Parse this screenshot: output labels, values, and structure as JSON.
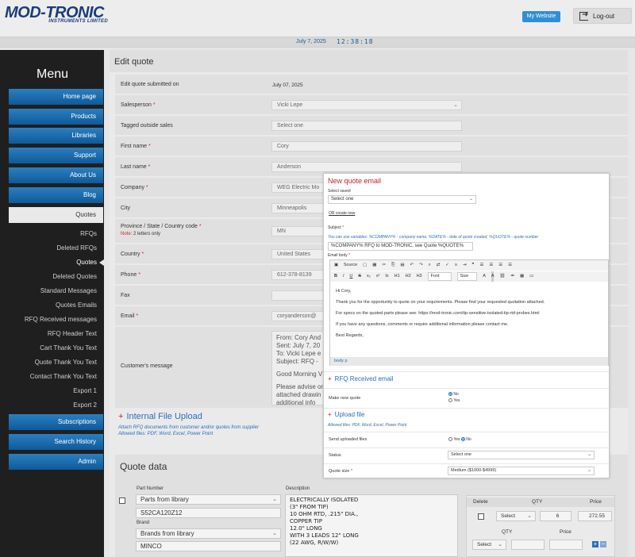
{
  "header": {
    "logo_main": "MOD-TRONIC",
    "logo_sub": "INSTRUMENTS LIMITED",
    "my_website": "My Website",
    "logout": "Log-out",
    "date": "July 7, 2025",
    "time": "12:38:18"
  },
  "sidebar": {
    "title": "Menu",
    "buttons": [
      "Home page",
      "Products",
      "Libraries",
      "Support",
      "About Us",
      "Blog",
      "Quotes"
    ],
    "sub_items": [
      "RFQs",
      "Deleted RFQs",
      "Quotes",
      "Deleted Quotes",
      "Standard Messages",
      "Quotes Emails",
      "RFQ Received messages",
      "RFQ Header Text",
      "Cart Thank You Text",
      "Quote Thank You Text",
      "Contact Thank You Text",
      "Export 1",
      "Export 2"
    ],
    "lower_buttons": [
      "Subscriptions",
      "Search History",
      "Admin"
    ]
  },
  "main": {
    "title": "Edit quote",
    "fields": [
      {
        "label": "Edit quote submitted on",
        "required": false,
        "value": "July 07, 2025"
      },
      {
        "label": "Salesperson",
        "required": true,
        "value": "Vicki Lepe"
      },
      {
        "label": "Tagged outside sales",
        "required": false,
        "value": "Select one"
      },
      {
        "label": "First name",
        "required": true,
        "value": "Cory"
      },
      {
        "label": "Last name",
        "required": true,
        "value": "Anderson"
      },
      {
        "label": "Company",
        "required": true,
        "value": "WEG Electric Mo"
      },
      {
        "label": "City",
        "required": false,
        "value": "Minneapolis"
      },
      {
        "label": "Province / State / Country code",
        "required": true,
        "value": "MN",
        "note_prefix": "Note:",
        "note": "2 letters only"
      },
      {
        "label": "Country",
        "required": true,
        "value": "United States"
      },
      {
        "label": "Phone",
        "required": true,
        "value": "612-378-8139"
      },
      {
        "label": "Fax",
        "required": false,
        "value": ""
      },
      {
        "label": "Email",
        "required": true,
        "value": "coryanderson@"
      },
      {
        "label": "Customer's message",
        "required": false,
        "value": ""
      }
    ],
    "message_lines": [
      "From: Cory And",
      "Sent: July 7, 20",
      "To: Vicki Lepe e",
      "Subject: RFQ -",
      "Good Morning V",
      "Please advise or",
      "attached drawin",
      "additional info"
    ],
    "upload": {
      "title": "Internal File Upload",
      "desc1": "Attach RFQ documents from customer and/or quotes from supplier",
      "desc2": "Allowed files: PDF, Word, Excel, Power Point"
    },
    "quote_data": {
      "title": "Quote data",
      "part_label": "Part Number",
      "part_select": "Parts from library",
      "part_number": "S52CA120Z12",
      "brand_label": "Brand",
      "brand_select": "Brands from library",
      "brand_value": "MINCO",
      "desc_label": "Description",
      "description": [
        "ELECTRICALLY ISOLATED",
        "(3\" FROM TIP)",
        "10 OHM RTD, .215\" DIA.,",
        "COPPER TIP",
        "12.0\" LONG",
        "WITH 3 LEADS 12\" LONG",
        "(22 AWG, R/W/W)"
      ],
      "col_delete": "Delete",
      "col_qty": "QTY",
      "col_price": "Price",
      "select": "Select",
      "qty_value": "6",
      "price_value": "272.55"
    }
  },
  "modal": {
    "title": "New quote email",
    "select_saved_label": "Select saved",
    "select_saved_value": "Select one",
    "or_create": "OR create new",
    "subject_label": "Subject",
    "hint": "You can use variables: %COMPANY% - company name, %DATE% - date of quote created, %QUOTE% - quote number",
    "subject_value": "%COMPANY% RFQ to MOD-TRONIC, see Quote %QUOTE%",
    "body_label": "Email body",
    "toolbar1": [
      "Source",
      "B",
      "I",
      "U",
      "S",
      "x₂",
      "x²"
    ],
    "toolbar2": [
      "B",
      "I",
      "U",
      "S",
      "x₂",
      "x²",
      "Ix",
      "H1",
      "H2",
      "H3",
      "Font",
      "Size",
      "A",
      "A"
    ],
    "body": [
      "Hi Cory,",
      "Thank you for the opportunity to quote on your requirements. Please find your requested quotation attached.",
      "For specs on the quoted parts please see: https://mod-tronic.com/tip-sensitive-isolated-tip-rtd-probes.html",
      "If you have any questions, comments or require additional information please contact me.",
      "Best Regards,"
    ],
    "status_path": "body  p",
    "rfq_section": "RFQ Received email",
    "make_new_quote": "Make new quote",
    "no": "No",
    "yes": "Yes",
    "upload_section": "Upload file",
    "upload_hint": "Allowed files: PDF, Word, Excel, Power Point",
    "send_uploaded": "Send uploaded files",
    "status_label": "Status",
    "status_value": "Select one",
    "quote_size_label": "Quote size",
    "quote_size_value": "Medium ($1000-$4999)"
  }
}
